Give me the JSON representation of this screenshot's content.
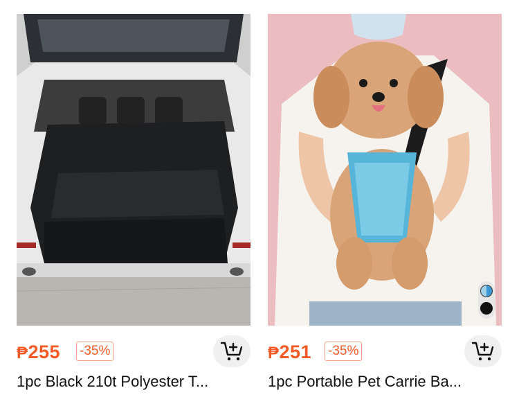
{
  "products": [
    {
      "currency": "₱",
      "price": "255",
      "discount": "-35%",
      "title": "1pc Black 210t Polyester T...",
      "image_icon": "car-trunk-cover-photo"
    },
    {
      "currency": "₱",
      "price": "251",
      "discount": "-35%",
      "title": "1pc Portable Pet Carrie Ba...",
      "image_icon": "dog-carrier-photo",
      "swatches": [
        "light-blue",
        "black"
      ]
    }
  ],
  "colors": {
    "price": "#f25a27",
    "discount_border": "#f5a285",
    "cart_bg": "#f0f0f0"
  }
}
